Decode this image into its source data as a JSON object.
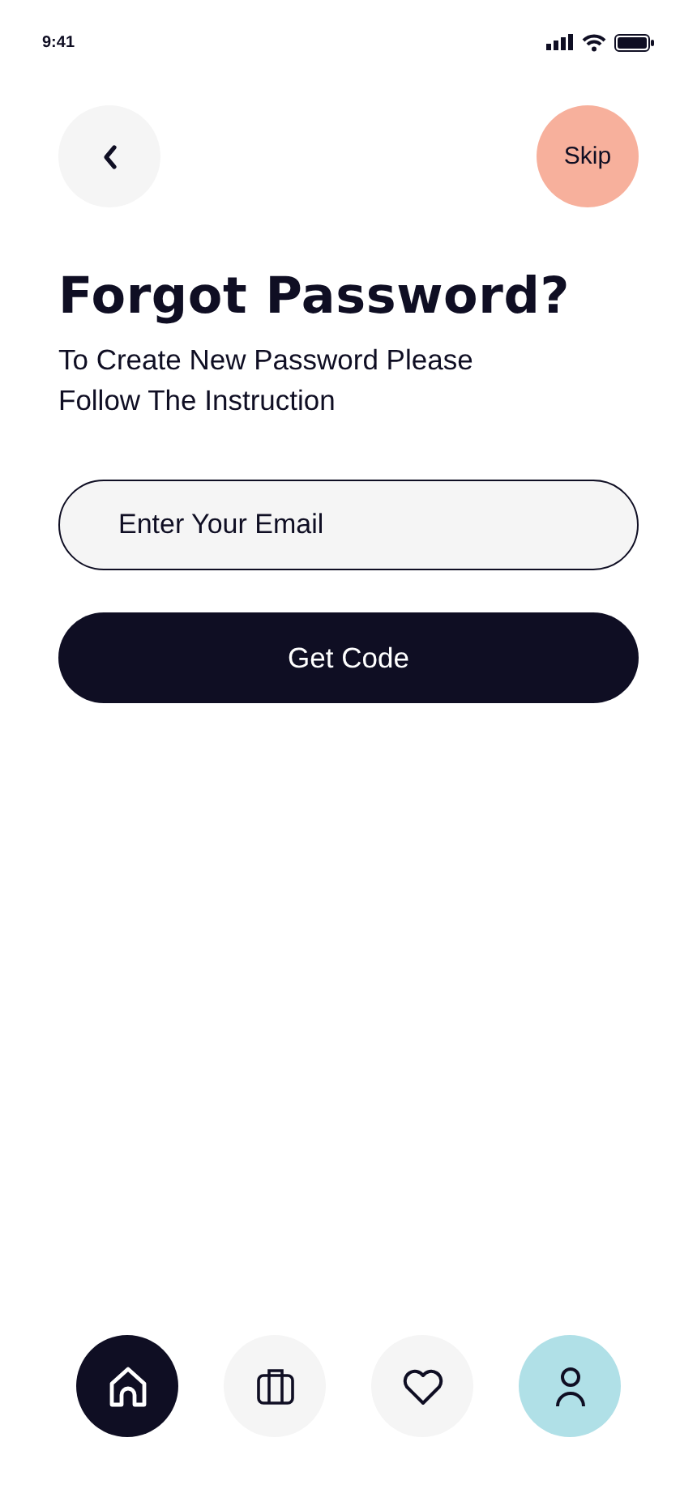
{
  "status_bar": {
    "time": "9:41"
  },
  "header": {
    "skip": "Skip"
  },
  "title": "Forgot Password?",
  "subtitle": "To Create New Password Please Follow The Instruction",
  "email_field": {
    "placeholder": "Enter Your Email"
  },
  "submit": "Get Code",
  "nav": [
    {
      "kind": "home",
      "selected": true,
      "color": "#0f0e23"
    },
    {
      "kind": "bag",
      "selected": false,
      "color": "#f5f5f5"
    },
    {
      "kind": "heart",
      "selected": false,
      "color": "#f5f5f5"
    },
    {
      "kind": "profile",
      "selected": false,
      "color": "#b0e0e7"
    }
  ]
}
